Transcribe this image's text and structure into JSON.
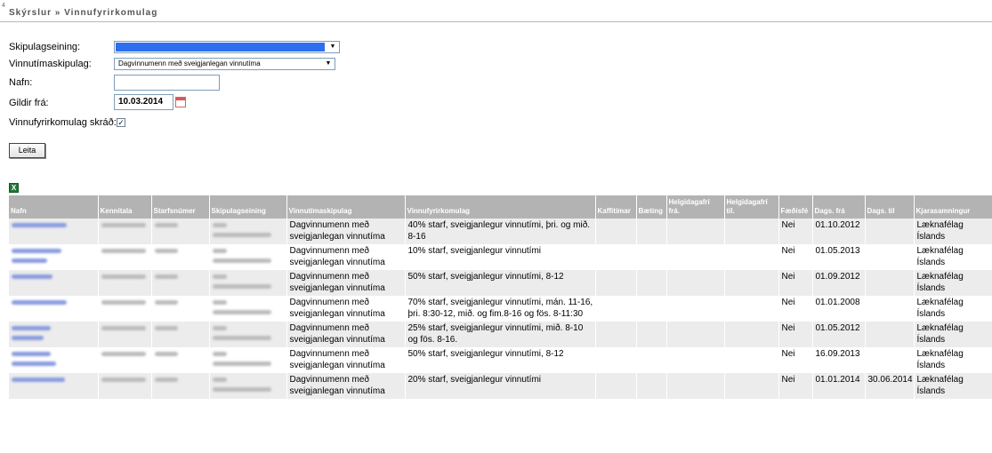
{
  "breadcrumb": {
    "marker": "4",
    "text": "Skýrslur » Vinnufyrirkomulag"
  },
  "form": {
    "skipulagseining": {
      "label": "Skipulagseining:"
    },
    "vinnutimaskipulag": {
      "label": "Vinnutímaskipulag:",
      "value": "Dagvinnumenn með sveigjanlegan vinnutíma"
    },
    "nafn": {
      "label": "Nafn:",
      "value": ""
    },
    "gildir_fra": {
      "label": "Gildir frá:",
      "value": "10.03.2014"
    },
    "vinnufyrirkomulag_skrad": {
      "label": "Vinnufyrirkomulag skráð:",
      "checked": true,
      "check_glyph": "✓"
    },
    "search_button": "Leita"
  },
  "export_icon": {
    "name": "excel-icon",
    "glyph": "X",
    "color": "#1f7a35"
  },
  "table": {
    "headers": {
      "nafn": "Nafn",
      "kennitala": "Kennitala",
      "starfsnumer": "Starfsnúmer",
      "skipulagseining": "Skipulagseining",
      "vinnutimaskipulag": "Vinnutímaskipulag",
      "vinnufyrirkomulag": "Vinnufyrirkomulag",
      "kaffitimar": "Kaffitímar",
      "baeting": "Bæting",
      "helgidagafri_fra": "Helgidagafrí frá.",
      "helgidagafri_til": "Helgidagafrí til.",
      "faedisfe": "Fæðisfé",
      "dags_fra": "Dags. frá",
      "dags_til": "Dags. til",
      "kjarasamningur": "Kjarasamningur"
    },
    "rows": [
      {
        "vinnutimaskipulag": "Dagvinnumenn með sveigjanlegan vinnutíma",
        "vinnufyrirkomulag": "40% starf, sveigjanlegur vinnutími, þri. og mið. 8-16",
        "faedisfe": "Nei",
        "dags_fra": "01.10.2012",
        "dags_til": "",
        "kjarasamningur": "Læknafélag Íslands"
      },
      {
        "vinnutimaskipulag": "Dagvinnumenn með sveigjanlegan vinnutíma",
        "vinnufyrirkomulag": "10% starf, sveigjanlegur vinnutími",
        "faedisfe": "Nei",
        "dags_fra": "01.05.2013",
        "dags_til": "",
        "kjarasamningur": "Læknafélag Íslands"
      },
      {
        "vinnutimaskipulag": "Dagvinnumenn með sveigjanlegan vinnutíma",
        "vinnufyrirkomulag": "50% starf, sveigjanlegur vinnutími, 8-12",
        "faedisfe": "Nei",
        "dags_fra": "01.09.2012",
        "dags_til": "",
        "kjarasamningur": "Læknafélag Íslands"
      },
      {
        "vinnutimaskipulag": "Dagvinnumenn með sveigjanlegan vinnutíma",
        "vinnufyrirkomulag": "70% starf, sveigjanlegur vinnutími, mán. 11-16, þri. 8:30-12, mið. og fim.8-16 og fös. 8-11:30",
        "faedisfe": "Nei",
        "dags_fra": "01.01.2008",
        "dags_til": "",
        "kjarasamningur": "Læknafélag Íslands"
      },
      {
        "vinnutimaskipulag": "Dagvinnumenn með sveigjanlegan vinnutíma",
        "vinnufyrirkomulag": "25% starf, sveigjanlegur vinnutími, mið. 8-10 og fös. 8-16.",
        "faedisfe": "Nei",
        "dags_fra": "01.05.2012",
        "dags_til": "",
        "kjarasamningur": "Læknafélag Íslands"
      },
      {
        "vinnutimaskipulag": "Dagvinnumenn með sveigjanlegan vinnutíma",
        "vinnufyrirkomulag": "50% starf, sveigjanlegur vinnutími, 8-12",
        "faedisfe": "Nei",
        "dags_fra": "16.09.2013",
        "dags_til": "",
        "kjarasamningur": "Læknafélag Íslands"
      },
      {
        "vinnutimaskipulag": "Dagvinnumenn með sveigjanlegan vinnutíma",
        "vinnufyrirkomulag": "20% starf, sveigjanlegur vinnutími",
        "faedisfe": "Nei",
        "dags_fra": "01.01.2014",
        "dags_til": "30.06.2014",
        "kjarasamningur": "Læknafélag Íslands"
      }
    ]
  }
}
